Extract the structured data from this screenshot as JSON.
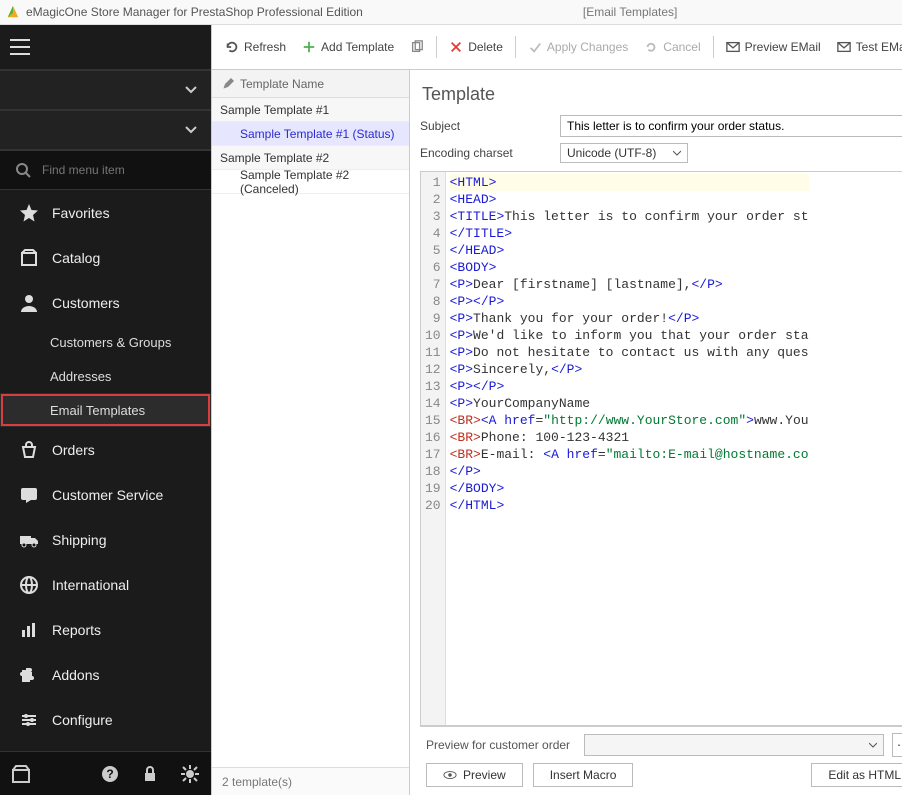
{
  "window": {
    "title": "eMagicOne Store Manager for PrestaShop Professional Edition",
    "subtitle": "[Email Templates]"
  },
  "sidebar": {
    "search_placeholder": "Find menu item",
    "items": [
      {
        "label": "Favorites"
      },
      {
        "label": "Catalog"
      },
      {
        "label": "Customers",
        "children": [
          {
            "label": "Customers & Groups"
          },
          {
            "label": "Addresses"
          },
          {
            "label": "Email Templates",
            "active": true,
            "highlight": true
          }
        ]
      },
      {
        "label": "Orders"
      },
      {
        "label": "Customer Service"
      },
      {
        "label": "Shipping"
      },
      {
        "label": "International"
      },
      {
        "label": "Reports"
      },
      {
        "label": "Addons"
      },
      {
        "label": "Configure"
      }
    ]
  },
  "toolbar": {
    "refresh": "Refresh",
    "add": "Add Template",
    "delete": "Delete",
    "apply": "Apply Changes",
    "cancel": "Cancel",
    "preview": "Preview EMail",
    "test": "Test EMail"
  },
  "tree": {
    "header": "Template Name",
    "groups": [
      {
        "name": "Sample Template #1",
        "children": [
          {
            "name": "Sample Template #1 (Status)",
            "selected": true
          }
        ]
      },
      {
        "name": "Sample Template #2",
        "children": [
          {
            "name": "Sample Template #2 (Canceled)"
          }
        ]
      }
    ],
    "footer": "2 template(s)"
  },
  "editor": {
    "heading": "Template",
    "subject_label": "Subject",
    "subject_value": "This letter is to confirm your order status.",
    "charset_label": "Encoding charset",
    "charset_value": "Unicode (UTF-8)",
    "code_lines": [
      [
        {
          "t": "<",
          "c": "ct-tag"
        },
        {
          "t": "HTML",
          "c": "ct-tag"
        },
        {
          "t": ">",
          "c": "ct-tag"
        }
      ],
      [
        {
          "t": "<",
          "c": "ct-tag"
        },
        {
          "t": "HEAD",
          "c": "ct-tag"
        },
        {
          "t": ">",
          "c": "ct-tag"
        }
      ],
      [
        {
          "t": "<",
          "c": "ct-tag"
        },
        {
          "t": "TITLE",
          "c": "ct-tag"
        },
        {
          "t": ">",
          "c": "ct-tag"
        },
        {
          "t": "This letter is to confirm your order st"
        }
      ],
      [
        {
          "t": "</",
          "c": "ct-tag"
        },
        {
          "t": "TITLE",
          "c": "ct-tag"
        },
        {
          "t": ">",
          "c": "ct-tag"
        }
      ],
      [
        {
          "t": "</",
          "c": "ct-tag"
        },
        {
          "t": "HEAD",
          "c": "ct-tag"
        },
        {
          "t": ">",
          "c": "ct-tag"
        }
      ],
      [
        {
          "t": "<",
          "c": "ct-tag"
        },
        {
          "t": "BODY",
          "c": "ct-tag"
        },
        {
          "t": ">",
          "c": "ct-tag"
        }
      ],
      [
        {
          "t": "<",
          "c": "ct-tag"
        },
        {
          "t": "P",
          "c": "ct-tag"
        },
        {
          "t": ">",
          "c": "ct-tag"
        },
        {
          "t": "Dear [firstname] [lastname],"
        },
        {
          "t": "</",
          "c": "ct-tag"
        },
        {
          "t": "P",
          "c": "ct-tag"
        },
        {
          "t": ">",
          "c": "ct-tag"
        }
      ],
      [
        {
          "t": "<",
          "c": "ct-tag"
        },
        {
          "t": "P",
          "c": "ct-tag"
        },
        {
          "t": ">",
          "c": "ct-tag"
        },
        {
          "t": "</",
          "c": "ct-tag"
        },
        {
          "t": "P",
          "c": "ct-tag"
        },
        {
          "t": ">",
          "c": "ct-tag"
        }
      ],
      [
        {
          "t": "<",
          "c": "ct-tag"
        },
        {
          "t": "P",
          "c": "ct-tag"
        },
        {
          "t": ">",
          "c": "ct-tag"
        },
        {
          "t": "Thank you for your order!"
        },
        {
          "t": "</",
          "c": "ct-tag"
        },
        {
          "t": "P",
          "c": "ct-tag"
        },
        {
          "t": ">",
          "c": "ct-tag"
        }
      ],
      [
        {
          "t": "<",
          "c": "ct-tag"
        },
        {
          "t": "P",
          "c": "ct-tag"
        },
        {
          "t": ">",
          "c": "ct-tag"
        },
        {
          "t": "We'd like to inform you that your order sta"
        }
      ],
      [
        {
          "t": "<",
          "c": "ct-tag"
        },
        {
          "t": "P",
          "c": "ct-tag"
        },
        {
          "t": ">",
          "c": "ct-tag"
        },
        {
          "t": "Do not hesitate to contact us with any ques"
        }
      ],
      [
        {
          "t": "<",
          "c": "ct-tag"
        },
        {
          "t": "P",
          "c": "ct-tag"
        },
        {
          "t": ">",
          "c": "ct-tag"
        },
        {
          "t": "Sincerely,"
        },
        {
          "t": "</",
          "c": "ct-tag"
        },
        {
          "t": "P",
          "c": "ct-tag"
        },
        {
          "t": ">",
          "c": "ct-tag"
        }
      ],
      [
        {
          "t": "<",
          "c": "ct-tag"
        },
        {
          "t": "P",
          "c": "ct-tag"
        },
        {
          "t": ">",
          "c": "ct-tag"
        },
        {
          "t": "</",
          "c": "ct-tag"
        },
        {
          "t": "P",
          "c": "ct-tag"
        },
        {
          "t": ">",
          "c": "ct-tag"
        }
      ],
      [
        {
          "t": "<",
          "c": "ct-tag"
        },
        {
          "t": "P",
          "c": "ct-tag"
        },
        {
          "t": ">",
          "c": "ct-tag"
        },
        {
          "t": "YourCompanyName"
        }
      ],
      [
        {
          "t": "<",
          "c": "ct-br"
        },
        {
          "t": "BR",
          "c": "ct-br"
        },
        {
          "t": ">",
          "c": "ct-br"
        },
        {
          "t": "<",
          "c": "ct-tag"
        },
        {
          "t": "A href",
          "c": "ct-tag"
        },
        {
          "t": "="
        },
        {
          "t": "\"http://www.YourStore.com\"",
          "c": "ct-str"
        },
        {
          "t": ">",
          "c": "ct-tag"
        },
        {
          "t": "www.You"
        }
      ],
      [
        {
          "t": "<",
          "c": "ct-br"
        },
        {
          "t": "BR",
          "c": "ct-br"
        },
        {
          "t": ">",
          "c": "ct-br"
        },
        {
          "t": "Phone: 100-123-4321"
        }
      ],
      [
        {
          "t": "<",
          "c": "ct-br"
        },
        {
          "t": "BR",
          "c": "ct-br"
        },
        {
          "t": ">",
          "c": "ct-br"
        },
        {
          "t": "E-mail: "
        },
        {
          "t": "<",
          "c": "ct-tag"
        },
        {
          "t": "A href",
          "c": "ct-tag"
        },
        {
          "t": "="
        },
        {
          "t": "\"mailto:E-mail@hostname.co",
          "c": "ct-str"
        }
      ],
      [
        {
          "t": "</",
          "c": "ct-tag"
        },
        {
          "t": "P",
          "c": "ct-tag"
        },
        {
          "t": ">",
          "c": "ct-tag"
        }
      ],
      [
        {
          "t": "</",
          "c": "ct-tag"
        },
        {
          "t": "BODY",
          "c": "ct-tag"
        },
        {
          "t": ">",
          "c": "ct-tag"
        }
      ],
      [
        {
          "t": "</",
          "c": "ct-tag"
        },
        {
          "t": "HTML",
          "c": "ct-tag"
        },
        {
          "t": ">",
          "c": "ct-tag"
        }
      ]
    ]
  },
  "footer": {
    "preview_label": "Preview for customer order",
    "preview_btn": "Preview",
    "macro_btn": "Insert Macro",
    "edit_btn": "Edit as HTML"
  }
}
